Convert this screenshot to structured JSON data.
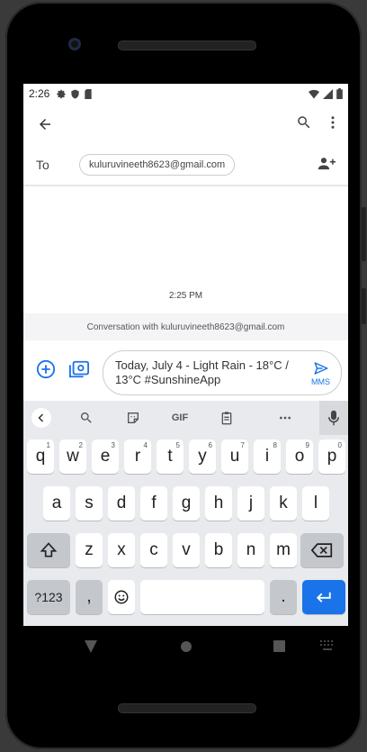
{
  "statusbar": {
    "time": "2:26"
  },
  "conversation": {
    "to_label": "To",
    "recipient": "kuluruvineeth8623@gmail.com",
    "timestamp": "2:25 PM",
    "info": "Conversation with kuluruvineeth8623@gmail.com"
  },
  "composer": {
    "message": "Today, July 4 - Light Rain - 18°C / 13°C #SunshineApp",
    "send_label": "MMS"
  },
  "keyboard": {
    "toolbar_gif": "GIF",
    "row1": [
      {
        "k": "q",
        "h": "1"
      },
      {
        "k": "w",
        "h": "2"
      },
      {
        "k": "e",
        "h": "3"
      },
      {
        "k": "r",
        "h": "4"
      },
      {
        "k": "t",
        "h": "5"
      },
      {
        "k": "y",
        "h": "6"
      },
      {
        "k": "u",
        "h": "7"
      },
      {
        "k": "i",
        "h": "8"
      },
      {
        "k": "o",
        "h": "9"
      },
      {
        "k": "p",
        "h": "0"
      }
    ],
    "row2": [
      "a",
      "s",
      "d",
      "f",
      "g",
      "h",
      "j",
      "k",
      "l"
    ],
    "row3": [
      "z",
      "x",
      "c",
      "v",
      "b",
      "n",
      "m"
    ],
    "sym_label": "?123",
    "comma": ",",
    "period": "."
  },
  "colors": {
    "accent": "#1a73e8",
    "keyboard_bg": "#e8eaed"
  }
}
